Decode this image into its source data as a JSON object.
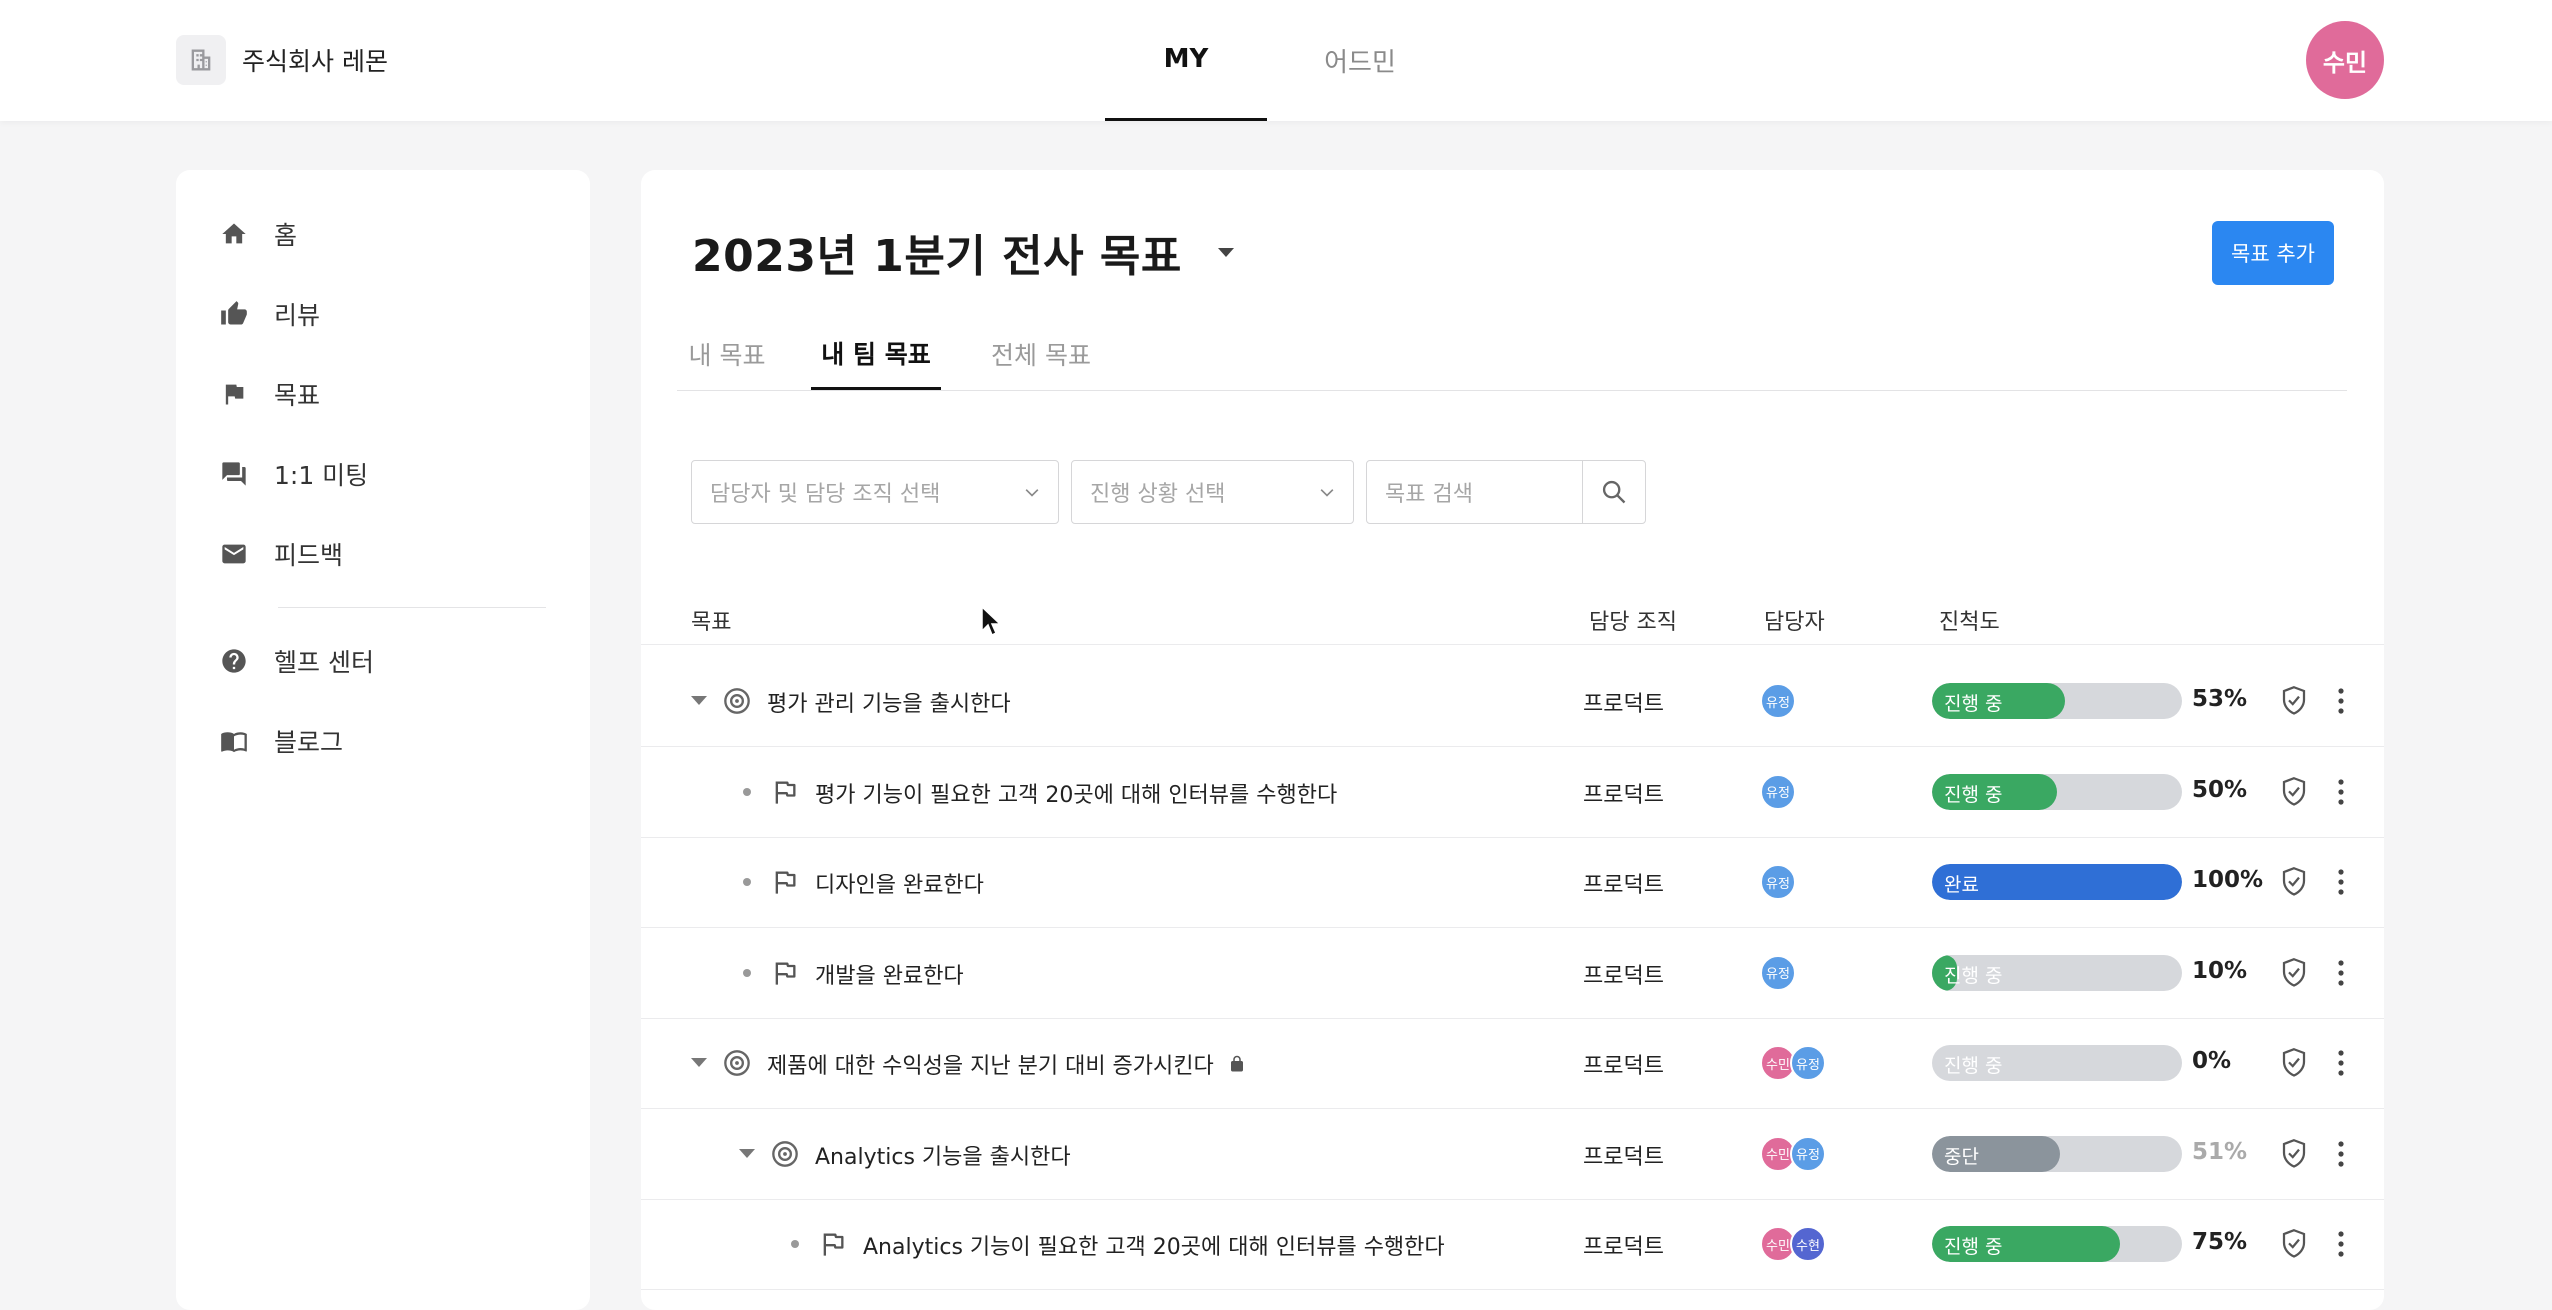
{
  "header": {
    "company": "주식회사 레몬",
    "tabs": [
      {
        "label": "MY",
        "active": true
      },
      {
        "label": "어드민",
        "active": false
      }
    ],
    "user_avatar": "수민"
  },
  "sidebar": {
    "items": [
      {
        "label": "홈",
        "icon": "home-icon"
      },
      {
        "label": "리뷰",
        "icon": "thumbs-up-icon"
      },
      {
        "label": "목표",
        "icon": "flag-icon"
      },
      {
        "label": "1:1 미팅",
        "icon": "chat-icon"
      },
      {
        "label": "피드백",
        "icon": "mail-icon"
      },
      {
        "label": "헬프 센터",
        "icon": "help-icon"
      },
      {
        "label": "블로그",
        "icon": "book-icon"
      }
    ]
  },
  "main": {
    "title": "2023년 1분기 전사 목표",
    "add_button": "목표 추가",
    "tabs": [
      {
        "label": "내 목표",
        "active": false
      },
      {
        "label": "내 팀 목표",
        "active": true
      },
      {
        "label": "전체 목표",
        "active": false
      }
    ],
    "filters": {
      "owner_placeholder": "담당자 및 담당 조직 선택",
      "status_placeholder": "진행 상황 선택",
      "search_placeholder": "목표 검색"
    },
    "columns": {
      "goal": "목표",
      "org": "담당 조직",
      "owner": "담당자",
      "progress": "진척도"
    },
    "rows": [
      {
        "title": "평가 관리 기능을 출시한다",
        "type": "objective",
        "level": 0,
        "expanded": true,
        "org": "프로덕트",
        "owners": [
          "유정"
        ],
        "status": "진행 중",
        "progress": 0.53,
        "progress_text": "53%",
        "locked": false
      },
      {
        "title": "평가 기능이 필요한 고객 20곳에 대해 인터뷰를 수행한다",
        "type": "key-result",
        "level": 1,
        "org": "프로덕트",
        "owners": [
          "유정"
        ],
        "status": "진행 중",
        "progress": 0.5,
        "progress_text": "50%"
      },
      {
        "title": "디자인을 완료한다",
        "type": "key-result",
        "level": 1,
        "org": "프로덕트",
        "owners": [
          "유정"
        ],
        "status": "완료",
        "progress": 1.0,
        "progress_text": "100%"
      },
      {
        "title": "개발을 완료한다",
        "type": "key-result",
        "level": 1,
        "org": "프로덕트",
        "owners": [
          "유정"
        ],
        "status": "진행 중",
        "progress": 0.1,
        "progress_text": "10%"
      },
      {
        "title": "제품에 대한 수익성을 지난 분기 대비 증가시킨다",
        "type": "objective",
        "level": 0,
        "expanded": true,
        "org": "프로덕트",
        "owners": [
          "수민",
          "유정"
        ],
        "status": "진행 중",
        "progress": 0.0,
        "progress_text": "0%",
        "locked": true
      },
      {
        "title": "Analytics 기능을 출시한다",
        "type": "objective",
        "level": 1,
        "expanded": true,
        "org": "프로덕트",
        "owners": [
          "수민",
          "유정"
        ],
        "status": "중단",
        "progress": 0.51,
        "progress_text": "51%",
        "muted": true
      },
      {
        "title": "Analytics 기능이 필요한 고객 20곳에 대해 인터뷰를 수행한다",
        "type": "key-result",
        "level": 2,
        "org": "프로덕트",
        "owners": [
          "수민",
          "수현"
        ],
        "status": "진행 중",
        "progress": 0.75,
        "progress_text": "75%"
      }
    ]
  },
  "colors": {
    "accent": "#2b87f1",
    "in_progress": "#3aa862",
    "done": "#2f6fd6",
    "stopped": "#8b949c",
    "track": "#d6d8dc",
    "avatar_sumin": "#e06b9a",
    "avatar_yujeong": "#5b9de6",
    "avatar_suhyeon": "#5466d1"
  }
}
